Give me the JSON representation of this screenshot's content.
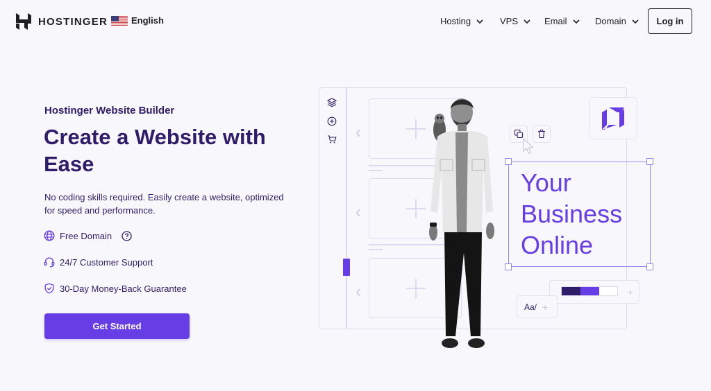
{
  "header": {
    "brand": "HOSTINGER",
    "language": "English",
    "nav": [
      {
        "label": "Hosting"
      },
      {
        "label": "VPS"
      },
      {
        "label": "Email"
      },
      {
        "label": "Domain"
      }
    ],
    "login_label": "Log in"
  },
  "hero": {
    "eyebrow": "Hostinger Website Builder",
    "title": "Create a Website with Ease",
    "subtitle": "No coding skills required. Easily create a website, optimized for speed and performance.",
    "features": [
      {
        "icon": "globe-icon",
        "label": "Free Domain",
        "has_help": true
      },
      {
        "icon": "headset-icon",
        "label": "24/7 Customer Support"
      },
      {
        "icon": "shield-check-icon",
        "label": "30-Day Money-Back Guarantee"
      }
    ],
    "cta_label": "Get Started"
  },
  "builder_mockup": {
    "sidebar_icons": [
      "layers-icon",
      "add-circle-icon",
      "cart-icon"
    ],
    "toolbar_icons": [
      "copy-icon",
      "trash-icon"
    ],
    "canvas_text": [
      "Your",
      "Business",
      "Online"
    ],
    "font_card_label": "Aa/",
    "palette": [
      "#2f1c6a",
      "#673de6",
      "#ffffff"
    ]
  },
  "colors": {
    "accent": "#673de6",
    "primary_text": "#2f1c6a",
    "background": "#f8f8fc"
  }
}
